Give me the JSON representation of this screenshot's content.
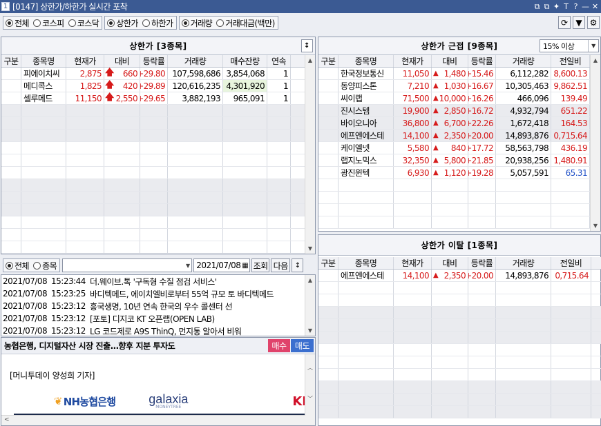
{
  "window": {
    "number": "1",
    "title": "[0147] 상한가/하한가 실시간 포착",
    "icons": [
      "restore-icon",
      "copy-icon",
      "pin-icon",
      "text-icon",
      "help-icon",
      "minimize-icon",
      "close-icon"
    ],
    "icon_glyphs": [
      "⧉",
      "⧉",
      "✦",
      "T",
      "?",
      "—",
      "✕"
    ]
  },
  "filters": {
    "market": [
      {
        "label": "전체",
        "on": true
      },
      {
        "label": "코스피",
        "on": false
      },
      {
        "label": "코스닥",
        "on": false
      }
    ],
    "limit": [
      {
        "label": "상한가",
        "on": true
      },
      {
        "label": "하한가",
        "on": false
      }
    ],
    "measure": [
      {
        "label": "거래량",
        "on": true
      },
      {
        "label": "거래대금(백만)",
        "on": false
      }
    ]
  },
  "upper": {
    "title": "상한가 [3종목]",
    "sort_icon": "↕",
    "columns": [
      "구분",
      "종목명",
      "현재가",
      "대비",
      "등락률",
      "거래량",
      "매수잔량",
      "연속"
    ],
    "rows": [
      {
        "name": "피에이치씨",
        "price": "2,875",
        "change": "660",
        "rate": "+29.80",
        "volume": "107,598,686",
        "bid": "3,854,068",
        "streak": "1",
        "flag": true,
        "green": false
      },
      {
        "name": "메디콕스",
        "price": "1,825",
        "change": "420",
        "rate": "+29.89",
        "volume": "120,616,235",
        "bid": "4,301,920",
        "streak": "1",
        "flag": false,
        "green": true
      },
      {
        "name": "셀루메드",
        "price": "11,150",
        "change": "2,550",
        "rate": "+29.65",
        "volume": "3,882,193",
        "bid": "965,091",
        "streak": "1",
        "flag": false,
        "green": false
      }
    ]
  },
  "near": {
    "title": "상한가 근접 [9종목]",
    "threshold": "15% 이상",
    "columns": [
      "구분",
      "종목명",
      "현재가",
      "대비",
      "등락률",
      "거래량",
      "전일비"
    ],
    "rows": [
      {
        "name": "한국정보통신",
        "price": "11,050",
        "change": "1,480",
        "rate": "+15.46",
        "volume": "6,112,282",
        "ratio": "8,600.13",
        "flag": false,
        "ratio_color": "red"
      },
      {
        "name": "동양피스톤",
        "price": "7,210",
        "change": "1,030",
        "rate": "+16.67",
        "volume": "10,305,463",
        "ratio": "9,862.51",
        "flag": true,
        "ratio_color": "red"
      },
      {
        "name": "씨이랩",
        "price": "71,500",
        "change": "10,000",
        "rate": "+16.26",
        "volume": "466,096",
        "ratio": "139.49",
        "flag": false,
        "ratio_color": "red"
      },
      {
        "name": "진시스템",
        "price": "19,900",
        "change": "2,850",
        "rate": "+16.72",
        "volume": "4,932,794",
        "ratio": "651.22",
        "flag": false,
        "ratio_color": "red"
      },
      {
        "name": "바이오니아",
        "price": "36,800",
        "change": "6,700",
        "rate": "+22.26",
        "volume": "1,672,418",
        "ratio": "164.53",
        "flag": false,
        "ratio_color": "red"
      },
      {
        "name": "에프엔에스테",
        "price": "14,100",
        "change": "2,350",
        "rate": "+20.00",
        "volume": "14,893,876",
        "ratio": "0,715.64",
        "flag": false,
        "ratio_color": "red"
      },
      {
        "name": "케이엘넷",
        "price": "5,580",
        "change": "840",
        "rate": "+17.72",
        "volume": "58,563,798",
        "ratio": "436.19",
        "flag": false,
        "ratio_color": "red"
      },
      {
        "name": "랩지노믹스",
        "price": "32,350",
        "change": "5,800",
        "rate": "+21.85",
        "volume": "20,938,256",
        "ratio": "1,480.91",
        "flag": false,
        "ratio_color": "red"
      },
      {
        "name": "광진윈텍",
        "price": "6,930",
        "change": "1,120",
        "rate": "+19.28",
        "volume": "5,057,591",
        "ratio": "65.31",
        "flag": false,
        "ratio_color": "blue"
      }
    ]
  },
  "departed": {
    "title": "상한가 이탈 [1종목]",
    "columns": [
      "구분",
      "종목명",
      "현재가",
      "대비",
      "등락률",
      "거래량",
      "전일비"
    ],
    "rows": [
      {
        "name": "에프엔에스테",
        "price": "14,100",
        "change": "2,350",
        "rate": "+20.00",
        "volume": "14,893,876",
        "ratio": "0,715.64"
      }
    ]
  },
  "newsbar": {
    "all_label": "전체",
    "item_label": "종목",
    "date": "2021/07/08",
    "query_label": "조회",
    "next_label": "다음"
  },
  "news": [
    {
      "date": "2021/07/08",
      "time": "15:23:44",
      "headline": "더.웨이브.톡  '구독형 수질 점검 서비스'"
    },
    {
      "date": "2021/07/08",
      "time": "15:23:25",
      "headline": "바디텍메드, 에이치엘비로부터 55억 규모 토 바디텍메드"
    },
    {
      "date": "2021/07/08",
      "time": "15:23:12",
      "headline": "흥국생명, 10년 연속 한국의 우수 콜센터 선"
    },
    {
      "date": "2021/07/08",
      "time": "15:23:12",
      "headline": "[포토] 디지코 KT 오픈랩(OPEN LAB)"
    },
    {
      "date": "2021/07/08",
      "time": "15:23:12",
      "headline": "LG 코드제로 A9S ThinQ, 먼지통 알아서 비워"
    }
  ],
  "article": {
    "title": "농협은행, 디지털자산 시장 진출…향후 지분 투자도",
    "buy": "매수",
    "sell": "매도",
    "byline": "[머니투데이 양성희 기자]",
    "banner": [
      "NH농협은행",
      "galaxia",
      "MONEYTREE",
      "KI"
    ]
  }
}
